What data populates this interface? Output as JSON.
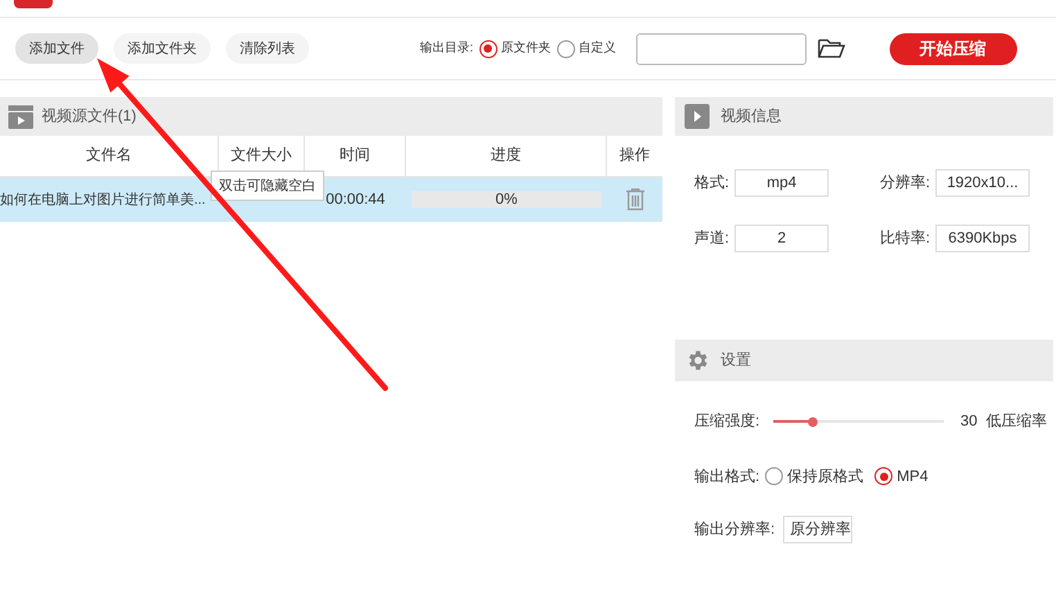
{
  "toolbar": {
    "buttons": [
      {
        "label": "添加文件",
        "selected": true
      },
      {
        "label": "添加文件夹",
        "selected": false
      },
      {
        "label": "清除列表",
        "selected": false
      }
    ],
    "output_dir": {
      "label": "输出目录:",
      "options": [
        {
          "label": "原文件夹",
          "selected": true
        },
        {
          "label": "自定义",
          "selected": false
        }
      ]
    },
    "start_button": "开始压缩"
  },
  "source_panel": {
    "title": "视频源文件(1)",
    "columns": [
      "文件名",
      "文件大小",
      "时间",
      "进度",
      "操作"
    ],
    "rows": [
      {
        "name": "如何在电脑上对图片进行简单美...",
        "time": "00:00:44",
        "progress": "0%",
        "selected": true
      }
    ],
    "tooltip": "双击可隐藏空白"
  },
  "video_info": {
    "title": "视频信息",
    "fields": [
      {
        "label": "格式:",
        "value": "mp4"
      },
      {
        "label": "分辨率:",
        "value": "1920x10..."
      },
      {
        "label": "声道:",
        "value": "2"
      },
      {
        "label": "比特率:",
        "value": "6390Kbps"
      }
    ]
  },
  "settings": {
    "title": "设置",
    "compression": {
      "label": "压缩强度:",
      "level": 0.23,
      "value": "30",
      "note": "低压缩率"
    },
    "output_format": {
      "label": "输出格式:",
      "options": [
        {
          "label": "保持原格式",
          "selected": false
        },
        {
          "label": "MP4",
          "selected": true
        }
      ]
    },
    "output_resolution": {
      "label": "输出分辨率:",
      "value": "原分辨率"
    }
  }
}
